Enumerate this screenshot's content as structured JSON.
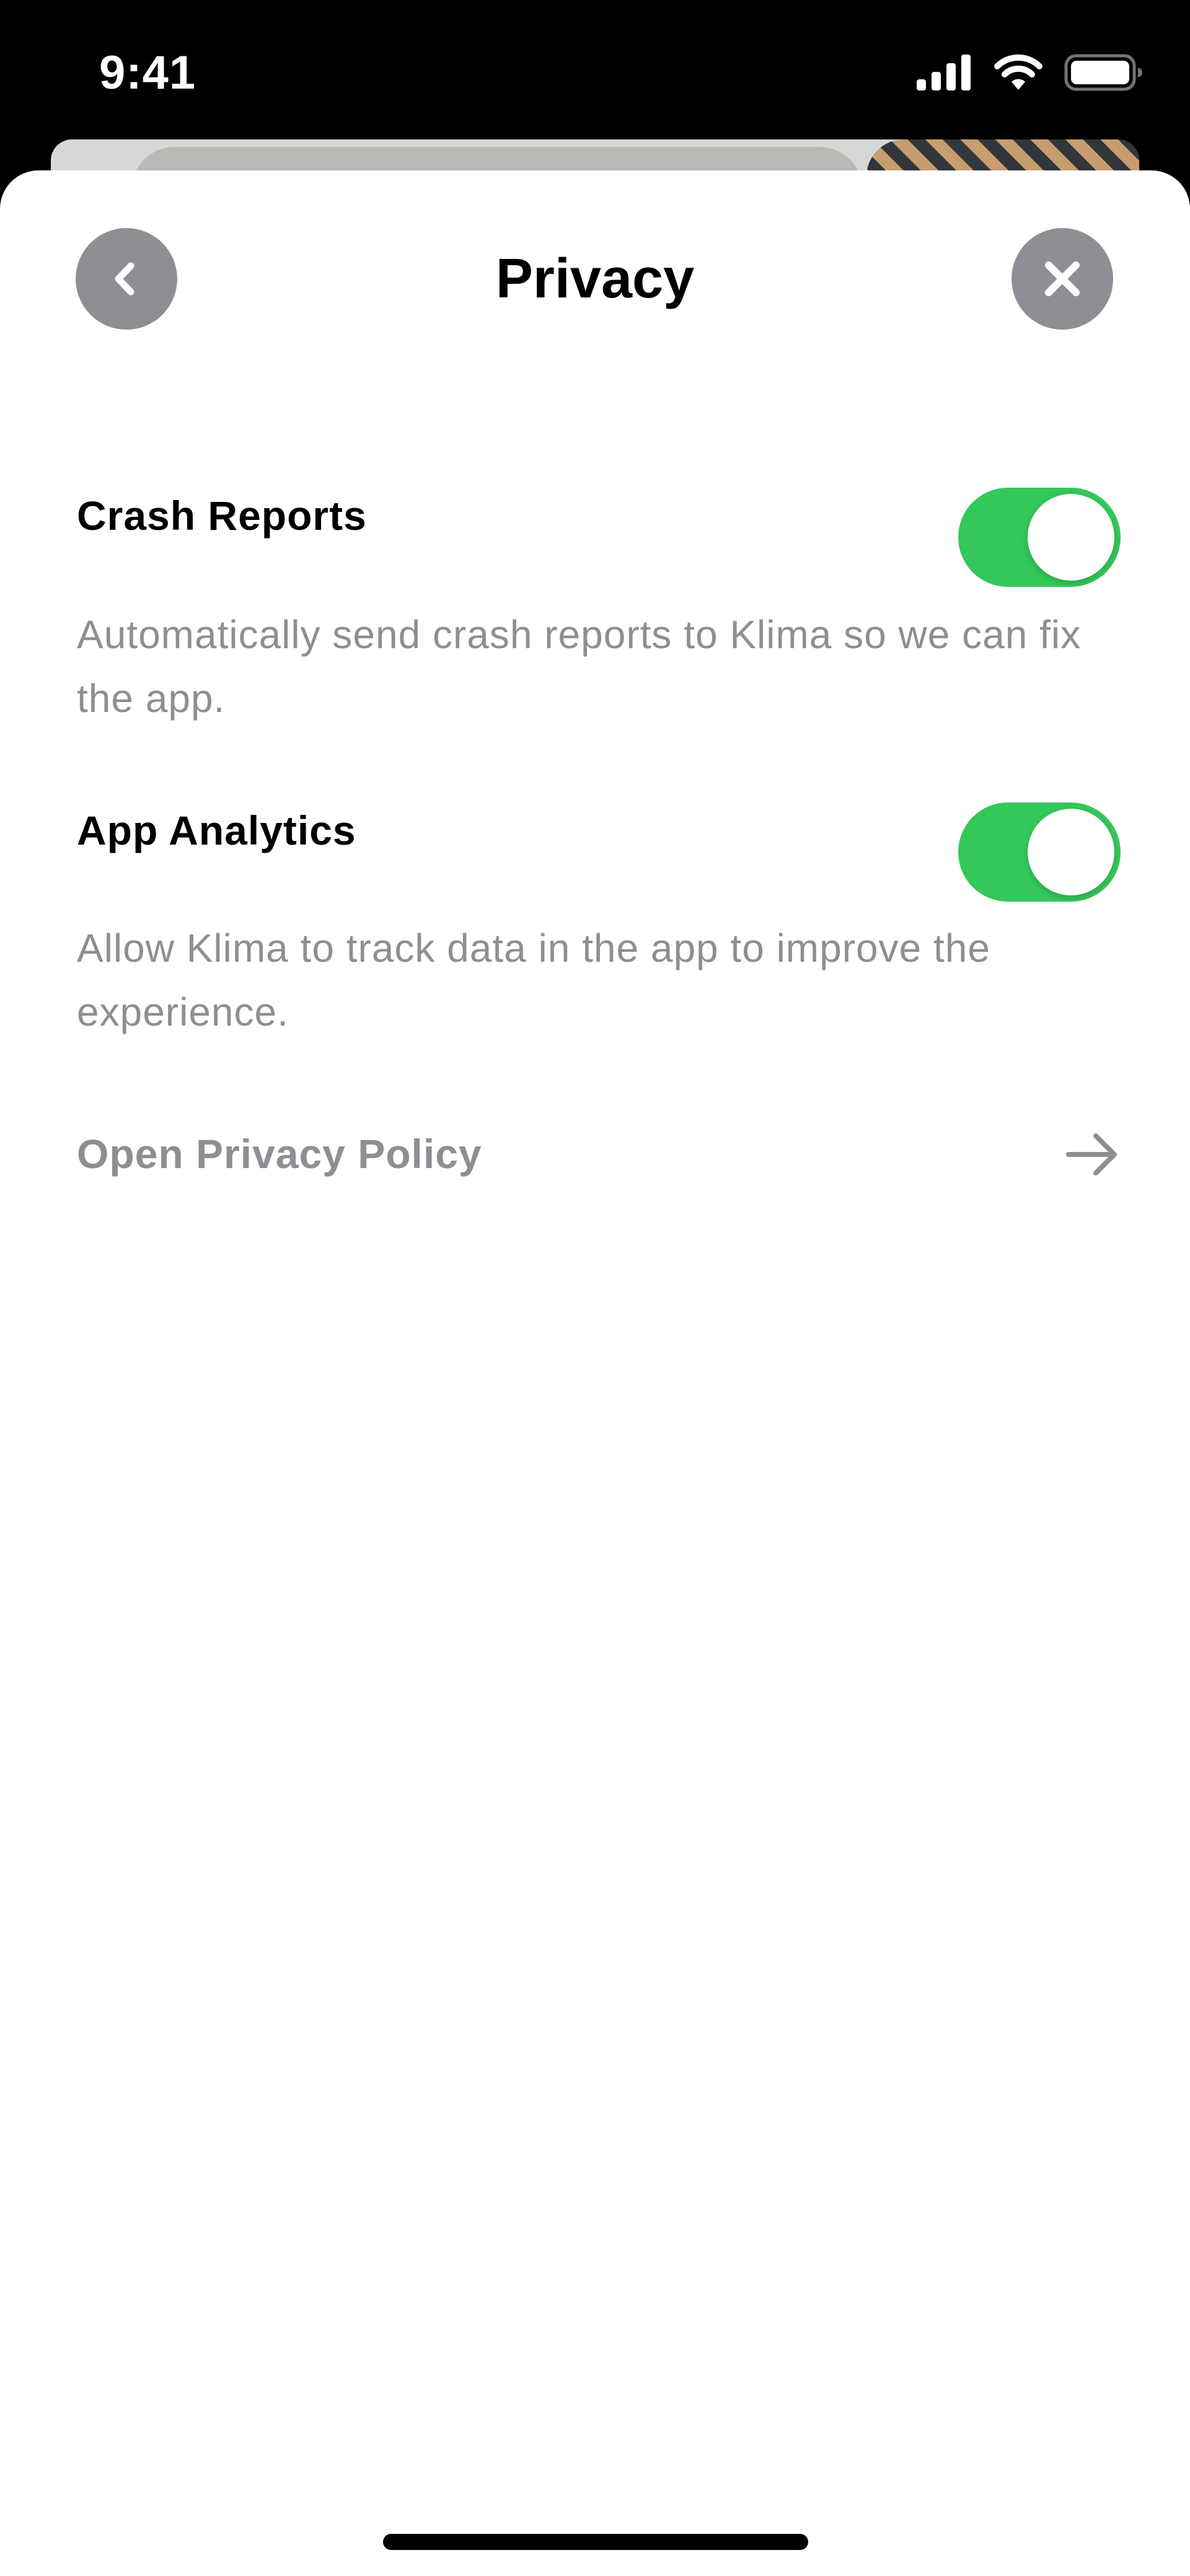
{
  "status_bar": {
    "time": "9:41",
    "icons": [
      "signal-icon",
      "wifi-icon",
      "battery-icon"
    ]
  },
  "header": {
    "title": "Privacy",
    "back_icon": "chevron-left-icon",
    "close_icon": "close-icon"
  },
  "settings": [
    {
      "title": "Crash Reports",
      "description": "Automatically send crash reports to Klima so we can fix the app.",
      "enabled": true
    },
    {
      "title": "App Analytics",
      "description": "Allow Klima to track data in the app to improve the experience.",
      "enabled": true
    }
  ],
  "privacy_link": {
    "label": "Open Privacy Policy",
    "icon": "arrow-right-icon"
  },
  "colors": {
    "toggle_on": "#34c759",
    "nav_button": "#8e8e94",
    "secondary_text": "#8e8e93"
  }
}
